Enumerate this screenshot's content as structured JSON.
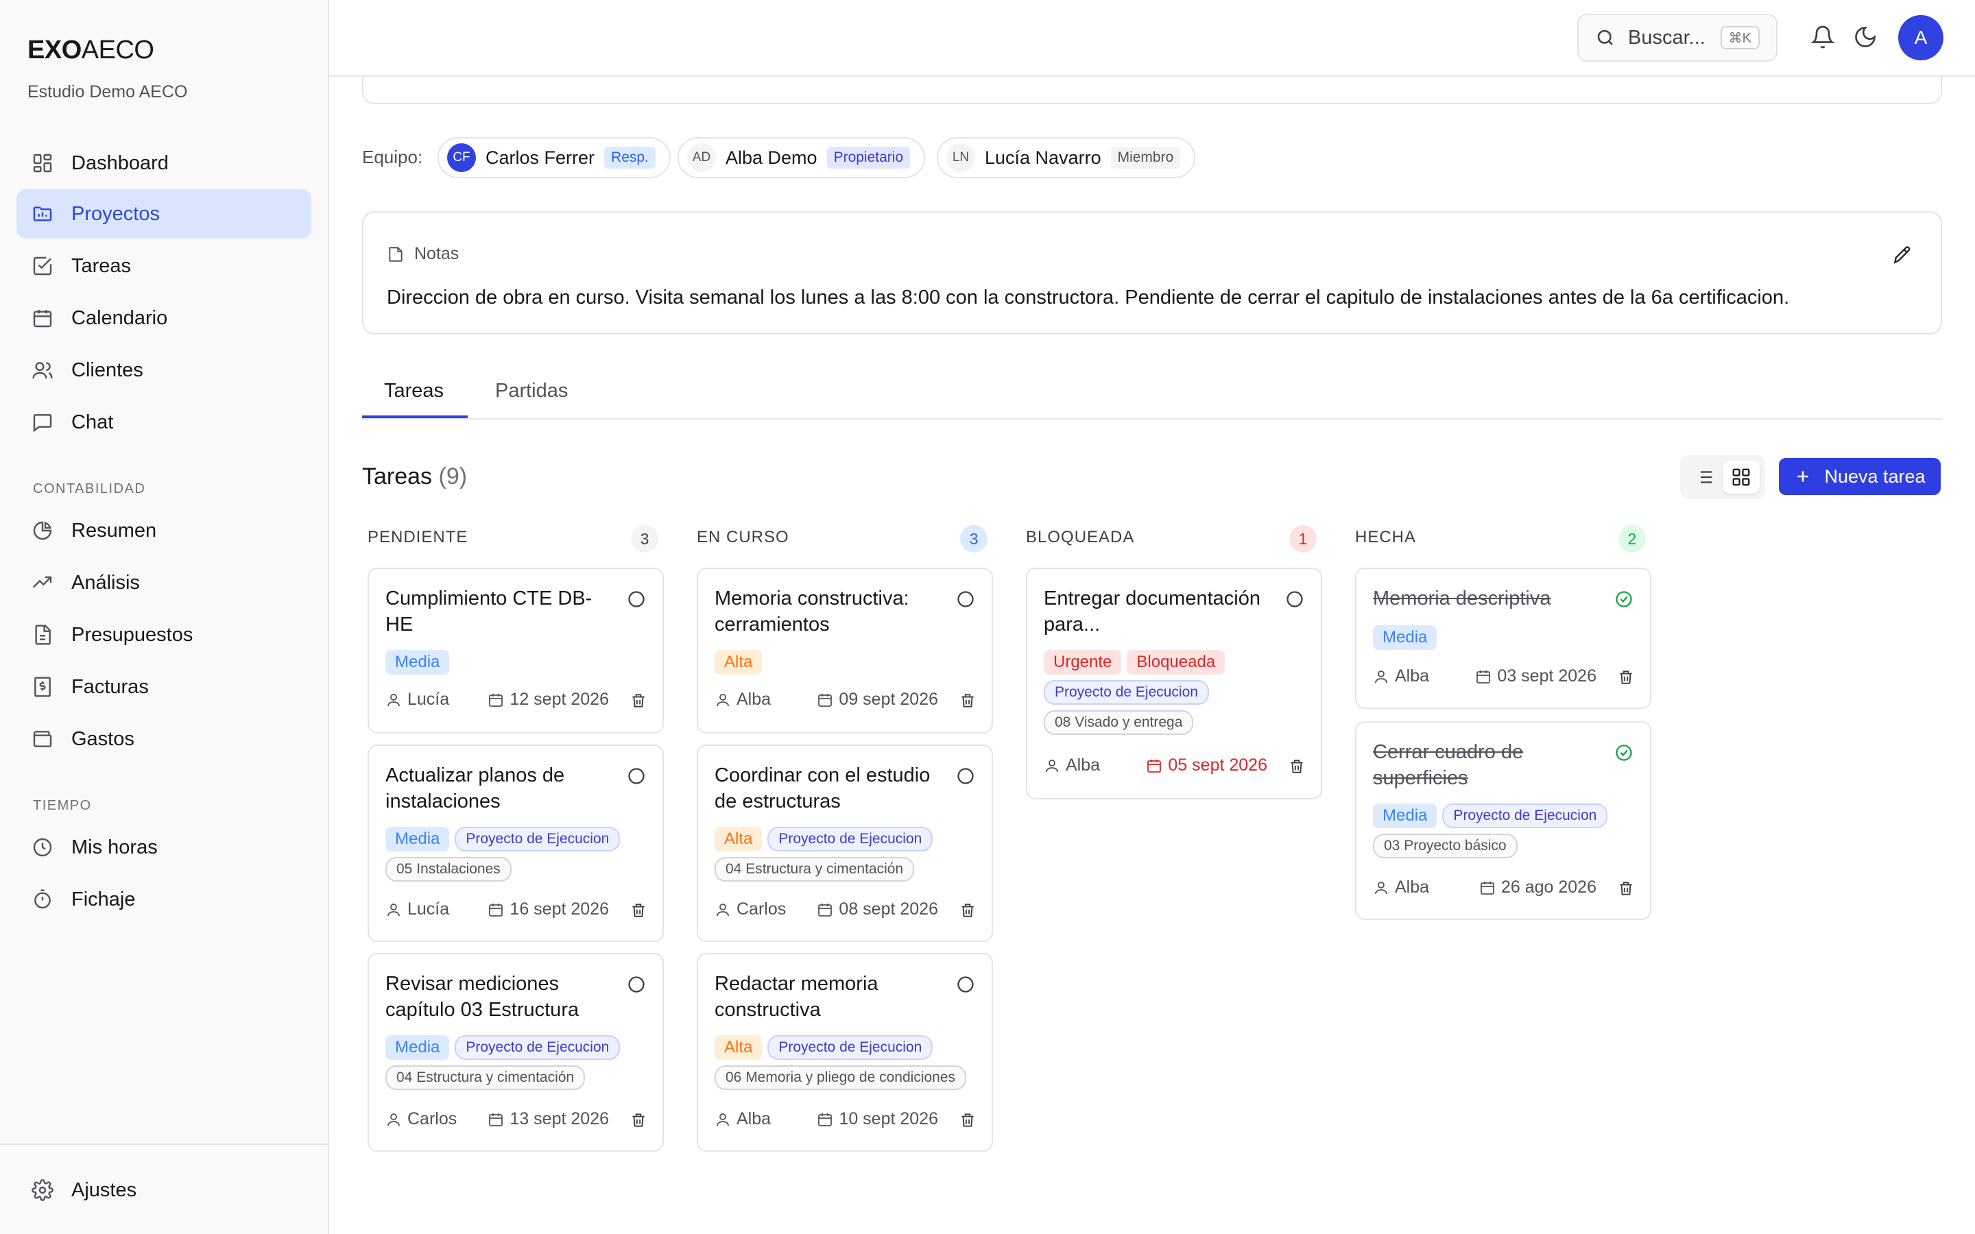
{
  "sidebar": {
    "brand_bold": "EXO",
    "brand_light": "AECO",
    "studio": "Estudio Demo AECO",
    "main_items": [
      {
        "label": "Dashboard",
        "icon": "dashboard-icon"
      },
      {
        "label": "Proyectos",
        "icon": "folder-icon",
        "active": true
      },
      {
        "label": "Tareas",
        "icon": "checkbox-icon"
      },
      {
        "label": "Calendario",
        "icon": "calendar-icon"
      },
      {
        "label": "Clientes",
        "icon": "users-icon"
      },
      {
        "label": "Chat",
        "icon": "chat-icon"
      }
    ],
    "section_accounting": "CONTABILIDAD",
    "accounting_items": [
      {
        "label": "Resumen",
        "icon": "pie-chart-icon"
      },
      {
        "label": "Análisis",
        "icon": "trending-up-icon"
      },
      {
        "label": "Presupuestos",
        "icon": "document-icon"
      },
      {
        "label": "Facturas",
        "icon": "invoice-icon"
      },
      {
        "label": "Gastos",
        "icon": "wallet-icon"
      }
    ],
    "section_time": "TIEMPO",
    "time_items": [
      {
        "label": "Mis horas",
        "icon": "clock-icon"
      },
      {
        "label": "Fichaje",
        "icon": "timer-icon"
      }
    ],
    "settings_label": "Ajustes"
  },
  "header": {
    "search_placeholder": "Buscar...",
    "search_shortcut": "⌘K",
    "avatar_initial": "A"
  },
  "team": {
    "label": "Equipo:",
    "members": [
      {
        "initials": "CF",
        "name": "Carlos Ferrer",
        "role": "Resp."
      },
      {
        "initials": "AD",
        "name": "Alba Demo",
        "role": "Propietario"
      },
      {
        "initials": "LN",
        "name": "Lucía Navarro",
        "role": "Miembro"
      }
    ]
  },
  "notes": {
    "label": "Notas",
    "text": "Direccion de obra en curso. Visita semanal los lunes a las 8:00 con la constructora. Pendiente de cerrar el capitulo de instalaciones antes de la 6a certificacion."
  },
  "tabs": [
    "Tareas",
    "Partidas"
  ],
  "tasks_section": {
    "title": "Tareas",
    "count": "(9)",
    "new_button": "Nueva tarea"
  },
  "columns": [
    {
      "title": "PENDIENTE",
      "count": "3",
      "cards": [
        {
          "title": "Cumplimiento CTE DB-HE",
          "priority": "Media",
          "phase": "",
          "partida": "",
          "user": "Lucía",
          "date": "12 sept 2026"
        },
        {
          "title": "Actualizar planos de instalaciones",
          "priority": "Media",
          "phase": "Proyecto de Ejecucion",
          "partida": "05 Instalaciones",
          "user": "Lucía",
          "date": "16 sept 2026"
        },
        {
          "title": "Revisar mediciones capítulo 03 Estructura",
          "priority": "Media",
          "phase": "Proyecto de Ejecucion",
          "partida": "04 Estructura y cimentación",
          "user": "Carlos",
          "date": "13 sept 2026"
        }
      ]
    },
    {
      "title": "EN CURSO",
      "count": "3",
      "cards": [
        {
          "title": "Memoria constructiva: cerramientos",
          "priority": "Alta",
          "phase": "",
          "partida": "",
          "user": "Alba",
          "date": "09 sept 2026"
        },
        {
          "title": "Coordinar con el estudio de estructuras",
          "priority": "Alta",
          "phase": "Proyecto de Ejecucion",
          "partida": "04 Estructura y cimentación",
          "user": "Carlos",
          "date": "08 sept 2026"
        },
        {
          "title": "Redactar memoria constructiva",
          "priority": "Alta",
          "phase": "Proyecto de Ejecucion",
          "partida": "06 Memoria y pliego de condiciones",
          "user": "Alba",
          "date": "10 sept 2026"
        }
      ]
    },
    {
      "title": "BLOQUEADA",
      "count": "1",
      "cards": [
        {
          "title": "Entregar documentación para...",
          "priority": "Urgente",
          "status_tag": "Bloqueada",
          "phase": "Proyecto de Ejecucion",
          "partida": "08 Visado y entrega",
          "user": "Alba",
          "date": "05 sept 2026",
          "overdue": true
        }
      ]
    },
    {
      "title": "HECHA",
      "count": "2",
      "cards": [
        {
          "title": "Memoria descriptiva",
          "priority": "Media",
          "phase": "",
          "partida": "",
          "user": "Alba",
          "date": "03 sept 2026",
          "done": true
        },
        {
          "title": "Cerrar cuadro de superficies",
          "priority": "Media",
          "phase": "Proyecto de Ejecucion",
          "partida": "03 Proyecto básico",
          "user": "Alba",
          "date": "26 ago 2026",
          "done": true
        }
      ]
    }
  ],
  "colors": {
    "accent": "#2f3ee0",
    "active_nav_bg": "#dbe4fd",
    "priority_media": "#3b82f6",
    "priority_alta": "#f97316",
    "priority_urgente": "#dc2626",
    "done_green": "#16a34a"
  }
}
